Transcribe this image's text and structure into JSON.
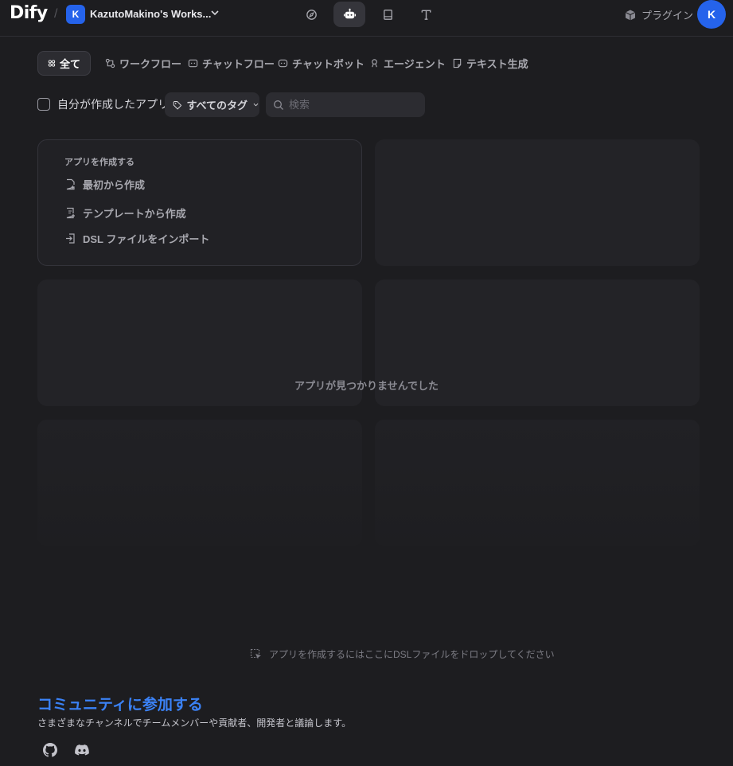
{
  "header": {
    "logo": "Dify",
    "separator": "/",
    "workspace_initial": "K",
    "workspace_name": "KazutoMakino's Works...",
    "nav_icons": [
      "explore-icon",
      "studio-robot-icon",
      "knowledge-book-icon",
      "tools-icon"
    ],
    "plugin_label": "プラグイン",
    "user_initial": "K"
  },
  "tabs": [
    {
      "label": "全て",
      "icon": "grid-icon",
      "active": true
    },
    {
      "label": "ワークフロー",
      "icon": "workflow-icon",
      "active": false
    },
    {
      "label": "チャットフロー",
      "icon": "chatflow-icon",
      "active": false
    },
    {
      "label": "チャットボット",
      "icon": "chatbot-icon",
      "active": false
    },
    {
      "label": "エージェント",
      "icon": "agent-icon",
      "active": false
    },
    {
      "label": "テキスト生成",
      "icon": "text-generation-icon",
      "active": false
    }
  ],
  "filters": {
    "mine_label": "自分が作成したアプリ",
    "tags_label": "すべてのタグ",
    "search_placeholder": "検索",
    "search_value": ""
  },
  "create_card": {
    "title": "アプリを作成する",
    "items": [
      {
        "label": "最初から作成",
        "icon": "new-file-icon"
      },
      {
        "label": "テンプレートから作成",
        "icon": "template-icon"
      },
      {
        "label": "DSL ファイルをインポート",
        "icon": "import-icon"
      }
    ]
  },
  "empty_message": "アプリが見つかりませんでした",
  "drop_hint": "アプリを作成するにはここにDSLファイルをドロップしてください",
  "community": {
    "title": "コミュニティに参加する",
    "description": "さまざまなチャンネルでチームメンバーや貢献者、開発者と議論します。",
    "links": [
      "github-icon",
      "discord-icon"
    ]
  },
  "colors": {
    "background": "#1d1d20",
    "accent": "#2563eb",
    "link": "#3b82f6"
  }
}
